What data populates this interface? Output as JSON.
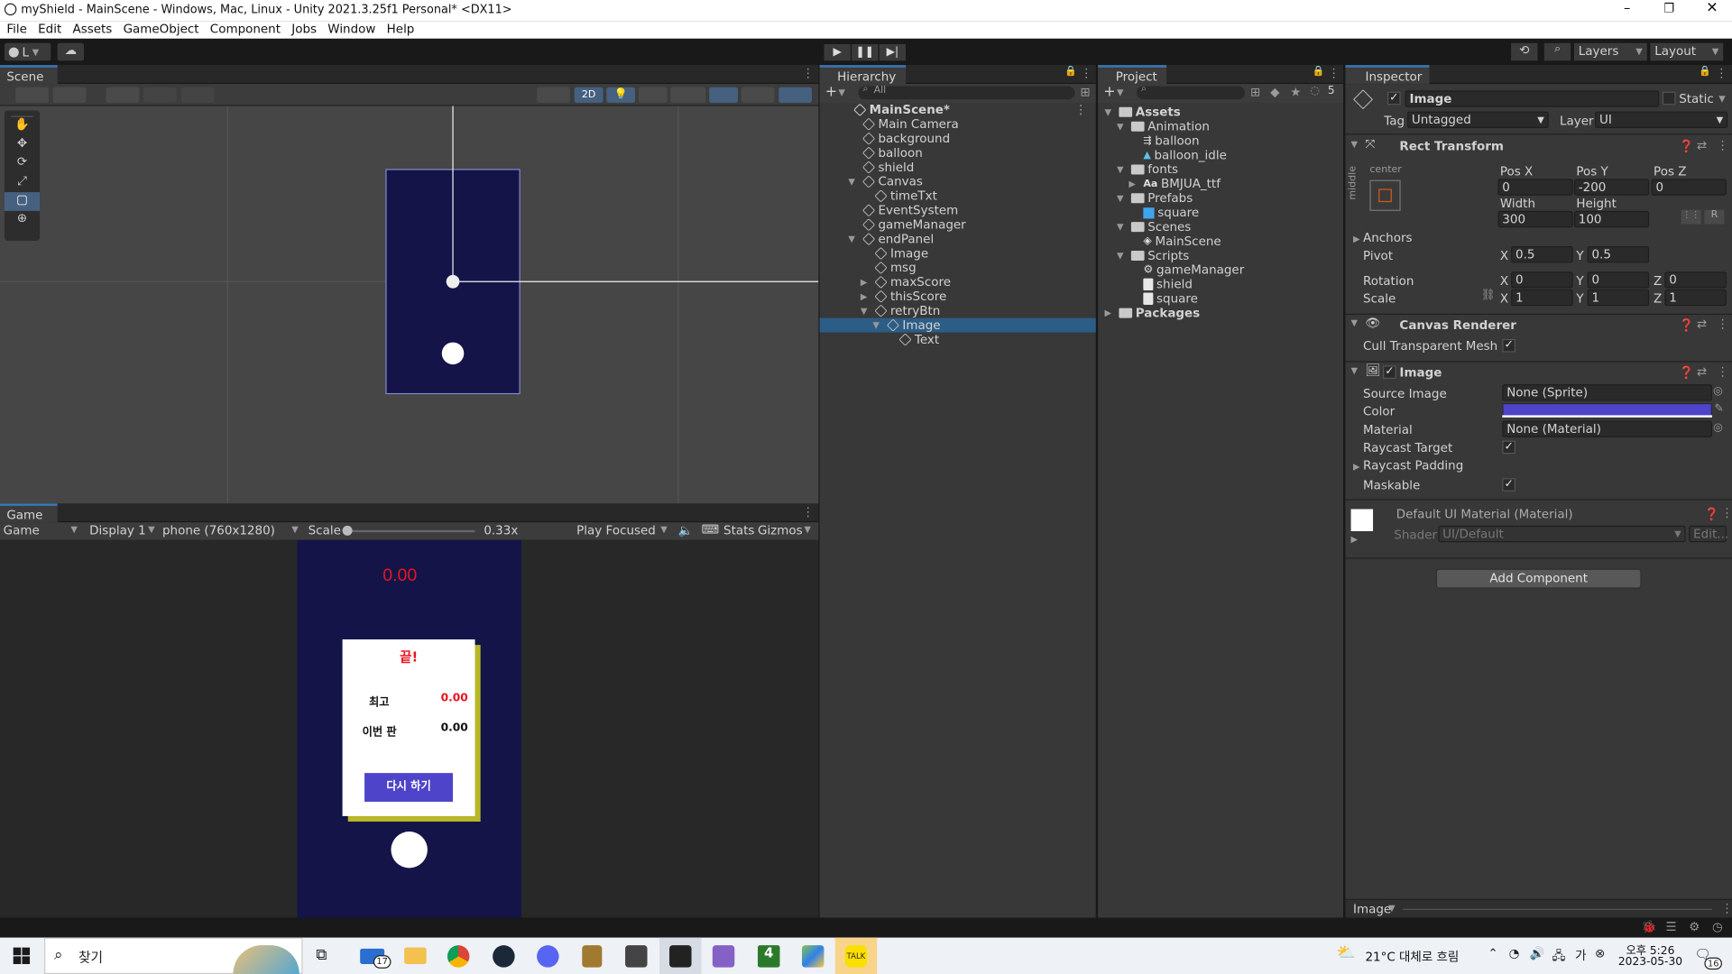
{
  "window": {
    "title": "myShield - MainScene - Windows, Mac, Linux - Unity 2021.3.25f1 Personal* <DX11>"
  },
  "menu": [
    "File",
    "Edit",
    "Assets",
    "GameObject",
    "Component",
    "Jobs",
    "Window",
    "Help"
  ],
  "toolbar": {
    "account": "L",
    "layers": "Layers",
    "layout": "Layout"
  },
  "scene": {
    "tab": "Scene",
    "mode_2d": "2D"
  },
  "game": {
    "tab": "Game",
    "view": "Game",
    "display": "Display 1",
    "resolution": "phone (760x1280)",
    "scale_label": "Scale",
    "scale_value": "0.33x",
    "scale_fraction": 0.0,
    "play_focused": "Play Focused",
    "stats": "Stats",
    "gizmos": "Gizmos",
    "timer": "0.00",
    "panel_title": "끝!",
    "best_label": "최고",
    "best_value": "0.00",
    "this_label": "이번 판",
    "this_value": "0.00",
    "retry": "다시 하기",
    "timer_color": "#e8141e",
    "panel_bg": "#141449",
    "button_color": "#4d44c9"
  },
  "hierarchy": {
    "tab": "Hierarchy",
    "search_placeholder": "All",
    "items": [
      {
        "label": "MainScene*",
        "depth": 0,
        "type": "scene"
      },
      {
        "label": "Main Camera",
        "depth": 1,
        "type": "go"
      },
      {
        "label": "background",
        "depth": 1,
        "type": "go"
      },
      {
        "label": "balloon",
        "depth": 1,
        "type": "go"
      },
      {
        "label": "shield",
        "depth": 1,
        "type": "go"
      },
      {
        "label": "Canvas",
        "depth": 1,
        "type": "go",
        "open": true
      },
      {
        "label": "timeTxt",
        "depth": 2,
        "type": "go"
      },
      {
        "label": "EventSystem",
        "depth": 1,
        "type": "go"
      },
      {
        "label": "gameManager",
        "depth": 1,
        "type": "go"
      },
      {
        "label": "endPanel",
        "depth": 1,
        "type": "go",
        "open": true
      },
      {
        "label": "Image",
        "depth": 2,
        "type": "go"
      },
      {
        "label": "msg",
        "depth": 2,
        "type": "go"
      },
      {
        "label": "maxScore",
        "depth": 2,
        "type": "go",
        "closed": true
      },
      {
        "label": "thisScore",
        "depth": 2,
        "type": "go",
        "closed": true
      },
      {
        "label": "retryBtn",
        "depth": 2,
        "type": "go",
        "open": true
      },
      {
        "label": "Image",
        "depth": 3,
        "type": "go",
        "open": true,
        "selected": true
      },
      {
        "label": "Text",
        "depth": 4,
        "type": "go"
      }
    ]
  },
  "project": {
    "tab": "Project",
    "hidden_count": "5",
    "items": [
      {
        "label": "Assets",
        "depth": 0,
        "type": "folder",
        "open": true,
        "bold": true
      },
      {
        "label": "Animation",
        "depth": 1,
        "type": "folder",
        "open": true
      },
      {
        "label": "balloon",
        "depth": 2,
        "type": "anim"
      },
      {
        "label": "balloon_idle",
        "depth": 2,
        "type": "clip"
      },
      {
        "label": "fonts",
        "depth": 1,
        "type": "folder",
        "open": true
      },
      {
        "label": "BMJUA_ttf",
        "depth": 2,
        "type": "font",
        "closed": true
      },
      {
        "label": "Prefabs",
        "depth": 1,
        "type": "folder",
        "open": true
      },
      {
        "label": "square",
        "depth": 2,
        "type": "prefab"
      },
      {
        "label": "Scenes",
        "depth": 1,
        "type": "folder",
        "open": true
      },
      {
        "label": "MainScene",
        "depth": 2,
        "type": "unity"
      },
      {
        "label": "Scripts",
        "depth": 1,
        "type": "folder",
        "open": true
      },
      {
        "label": "gameManager",
        "depth": 2,
        "type": "gear"
      },
      {
        "label": "shield",
        "depth": 2,
        "type": "script"
      },
      {
        "label": "square",
        "depth": 2,
        "type": "script"
      },
      {
        "label": "Packages",
        "depth": 0,
        "type": "folder",
        "closed": true,
        "bold": true
      }
    ]
  },
  "inspector": {
    "tab": "Inspector",
    "name": "Image",
    "static": "Static",
    "tag_label": "Tag",
    "tag": "Untagged",
    "layer_label": "Layer",
    "layer": "UI",
    "rect": {
      "title": "Rect Transform",
      "anchor_h": "center",
      "anchor_v": "middle",
      "pos_x_label": "Pos X",
      "pos_y_label": "Pos Y",
      "pos_z_label": "Pos Z",
      "pos_x": "0",
      "pos_y": "-200",
      "pos_z": "0",
      "width_label": "Width",
      "height_label": "Height",
      "width": "300",
      "height": "100",
      "anchors": "Anchors",
      "pivot": "Pivot",
      "pivot_x": "0.5",
      "pivot_y": "0.5",
      "rotation": "Rotation",
      "rot_x": "0",
      "rot_y": "0",
      "rot_z": "0",
      "scale": "Scale",
      "scale_x": "1",
      "scale_y": "1",
      "scale_z": "1",
      "x": "X",
      "y": "Y",
      "z": "Z",
      "r": "R"
    },
    "canvas_renderer": {
      "title": "Canvas Renderer",
      "cull": "Cull Transparent Mesh"
    },
    "image": {
      "title": "Image",
      "source_label": "Source Image",
      "source": "None (Sprite)",
      "color_label": "Color",
      "color": "#4d44c9",
      "material_label": "Material",
      "material": "None (Material)",
      "raycast_target": "Raycast Target",
      "raycast_padding": "Raycast Padding",
      "maskable": "Maskable"
    },
    "material": {
      "title": "Default UI Material (Material)",
      "shader_label": "Shader",
      "shader": "UI/Default",
      "edit": "Edit..."
    },
    "add_component": "Add Component",
    "footer": "Image"
  },
  "taskbar": {
    "search": "찾기",
    "mail_badge": "17",
    "weather": "21°C 대체로 흐림",
    "time": "오후 5:26",
    "date": "2023-05-30",
    "notif": "16"
  }
}
